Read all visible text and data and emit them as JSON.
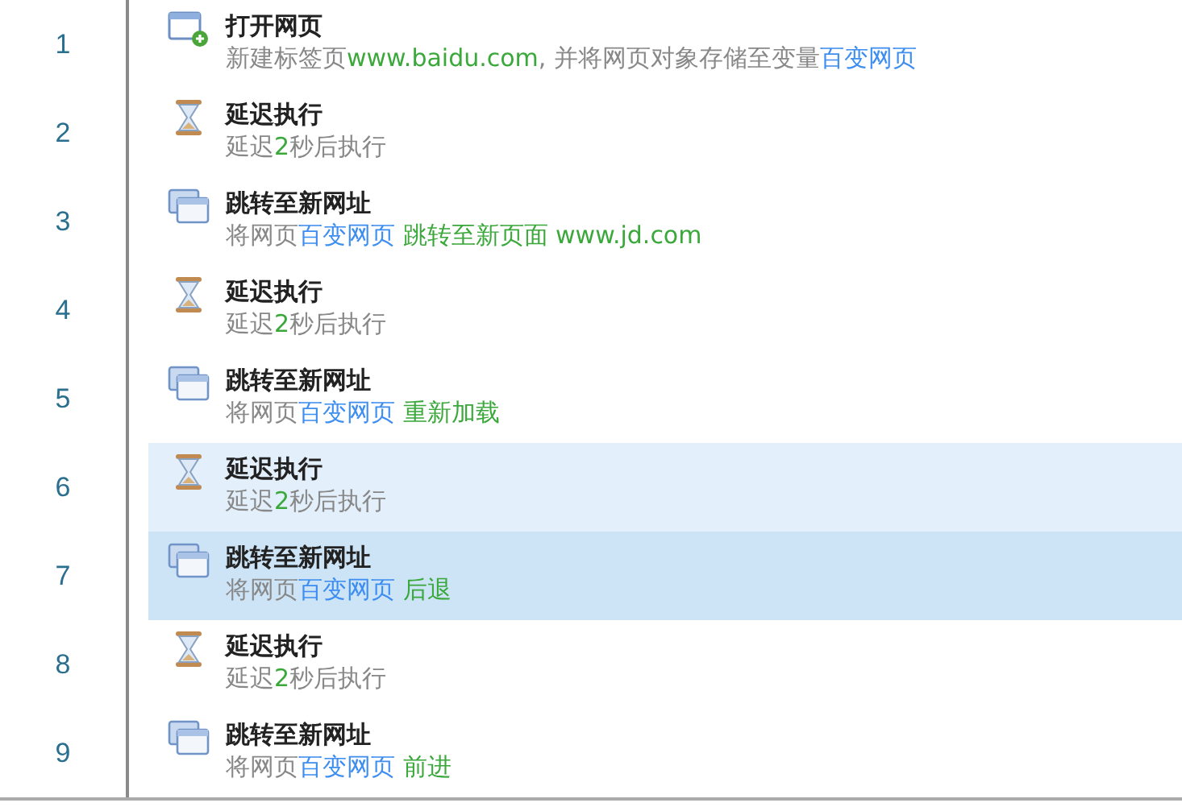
{
  "steps": [
    {
      "number": "1",
      "kind": "open",
      "title": "打开网页",
      "selected": false,
      "hovered": false,
      "description": [
        {
          "text": "新建标签页",
          "kind": "plain"
        },
        {
          "text": "www.baidu.com",
          "kind": "value"
        },
        {
          "text": ", 并将网页对象存储至变量",
          "kind": "plain"
        },
        {
          "text": "百变网页",
          "kind": "variable"
        }
      ]
    },
    {
      "number": "2",
      "kind": "delay",
      "title": "延迟执行",
      "selected": false,
      "hovered": false,
      "description": [
        {
          "text": "延迟",
          "kind": "plain"
        },
        {
          "text": "2",
          "kind": "value"
        },
        {
          "text": "秒后执行",
          "kind": "plain"
        }
      ]
    },
    {
      "number": "3",
      "kind": "navigate",
      "title": "跳转至新网址",
      "selected": false,
      "hovered": false,
      "description": [
        {
          "text": "将网页",
          "kind": "plain"
        },
        {
          "text": "百变网页",
          "kind": "variable"
        },
        {
          "text": " 跳转至新页面 www.jd.com",
          "kind": "value"
        }
      ]
    },
    {
      "number": "4",
      "kind": "delay",
      "title": "延迟执行",
      "selected": false,
      "hovered": false,
      "description": [
        {
          "text": "延迟",
          "kind": "plain"
        },
        {
          "text": "2",
          "kind": "value"
        },
        {
          "text": "秒后执行",
          "kind": "plain"
        }
      ]
    },
    {
      "number": "5",
      "kind": "navigate",
      "title": "跳转至新网址",
      "selected": false,
      "hovered": false,
      "description": [
        {
          "text": "将网页",
          "kind": "plain"
        },
        {
          "text": "百变网页",
          "kind": "variable"
        },
        {
          "text": " 重新加载",
          "kind": "value"
        }
      ]
    },
    {
      "number": "6",
      "kind": "delay",
      "title": "延迟执行",
      "selected": false,
      "hovered": true,
      "description": [
        {
          "text": "延迟",
          "kind": "plain"
        },
        {
          "text": "2",
          "kind": "value"
        },
        {
          "text": "秒后执行",
          "kind": "plain"
        }
      ]
    },
    {
      "number": "7",
      "kind": "navigate",
      "title": "跳转至新网址",
      "selected": true,
      "hovered": false,
      "description": [
        {
          "text": "将网页",
          "kind": "plain"
        },
        {
          "text": "百变网页",
          "kind": "variable"
        },
        {
          "text": " 后退",
          "kind": "value"
        }
      ]
    },
    {
      "number": "8",
      "kind": "delay",
      "title": "延迟执行",
      "selected": false,
      "hovered": false,
      "description": [
        {
          "text": "延迟",
          "kind": "plain"
        },
        {
          "text": "2",
          "kind": "value"
        },
        {
          "text": "秒后执行",
          "kind": "plain"
        }
      ]
    },
    {
      "number": "9",
      "kind": "navigate",
      "title": "跳转至新网址",
      "selected": false,
      "hovered": false,
      "description": [
        {
          "text": "将网页",
          "kind": "plain"
        },
        {
          "text": "百变网页",
          "kind": "variable"
        },
        {
          "text": " 前进",
          "kind": "value"
        }
      ]
    }
  ]
}
